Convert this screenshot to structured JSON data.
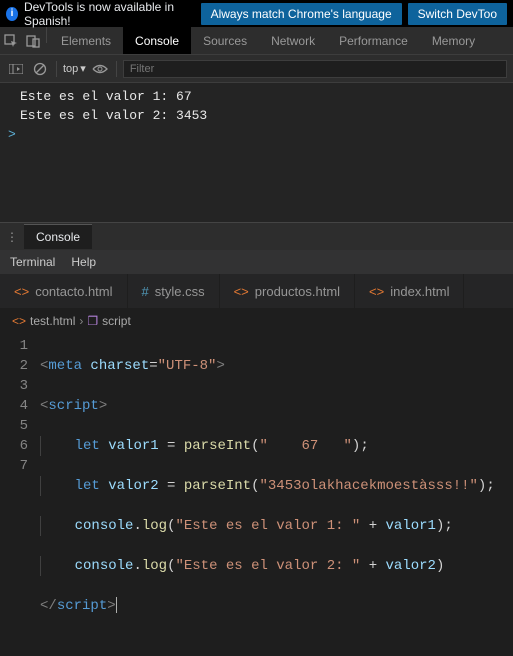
{
  "banner": {
    "text": "DevTools is now available in Spanish!",
    "btn1": "Always match Chrome's language",
    "btn2": "Switch DevToo"
  },
  "devtoolsTabs": {
    "elements": "Elements",
    "console": "Console",
    "sources": "Sources",
    "network": "Network",
    "performance": "Performance",
    "memory": "Memory"
  },
  "toolbar": {
    "context": "top",
    "filterPlaceholder": "Filter"
  },
  "console": {
    "line1": "Este es el valor 1: 67",
    "line2": "Este es el valor 2: 3453",
    "prompt": ">"
  },
  "drawer": {
    "tab": "Console"
  },
  "vscodeMenu": {
    "terminal": "Terminal",
    "help": "Help"
  },
  "editorTabs": {
    "contacto": "contacto.html",
    "style": "style.css",
    "productos": "productos.html",
    "index": "index.html"
  },
  "breadcrumb": {
    "file": "test.html",
    "node": "script"
  },
  "lineNumbers": {
    "l1": "1",
    "l2": "2",
    "l3": "3",
    "l4": "4",
    "l5": "5",
    "l6": "6",
    "l7": "7"
  },
  "code": {
    "meta_open": "<",
    "meta_tag": "meta ",
    "meta_attr": "charset",
    "meta_eq": "=",
    "meta_val": "\"UTF-8\"",
    "meta_close": ">",
    "script_open": "<",
    "script_tag": "script",
    "script_close": ">",
    "let1": "let ",
    "v1": "valor1 ",
    "eq": "= ",
    "parseInt": "parseInt",
    "lp": "(",
    "rp": ")",
    "semi": ";",
    "str1": "\"    67   \"",
    "let2": "let ",
    "v2": "valor2 ",
    "str2": "\"3453olakhacekmoestàsss!!\"",
    "console": "console",
    "dot": ".",
    "log": "log",
    "str3": "\"Este es el valor 1: \"",
    "plus": " + ",
    "v1r": "valor1",
    "str4": "\"Este es el valor 2: \"",
    "v2r": "valor2",
    "endscript_open": "</",
    "endscript_tag": "script",
    "endscript_close": ">"
  }
}
